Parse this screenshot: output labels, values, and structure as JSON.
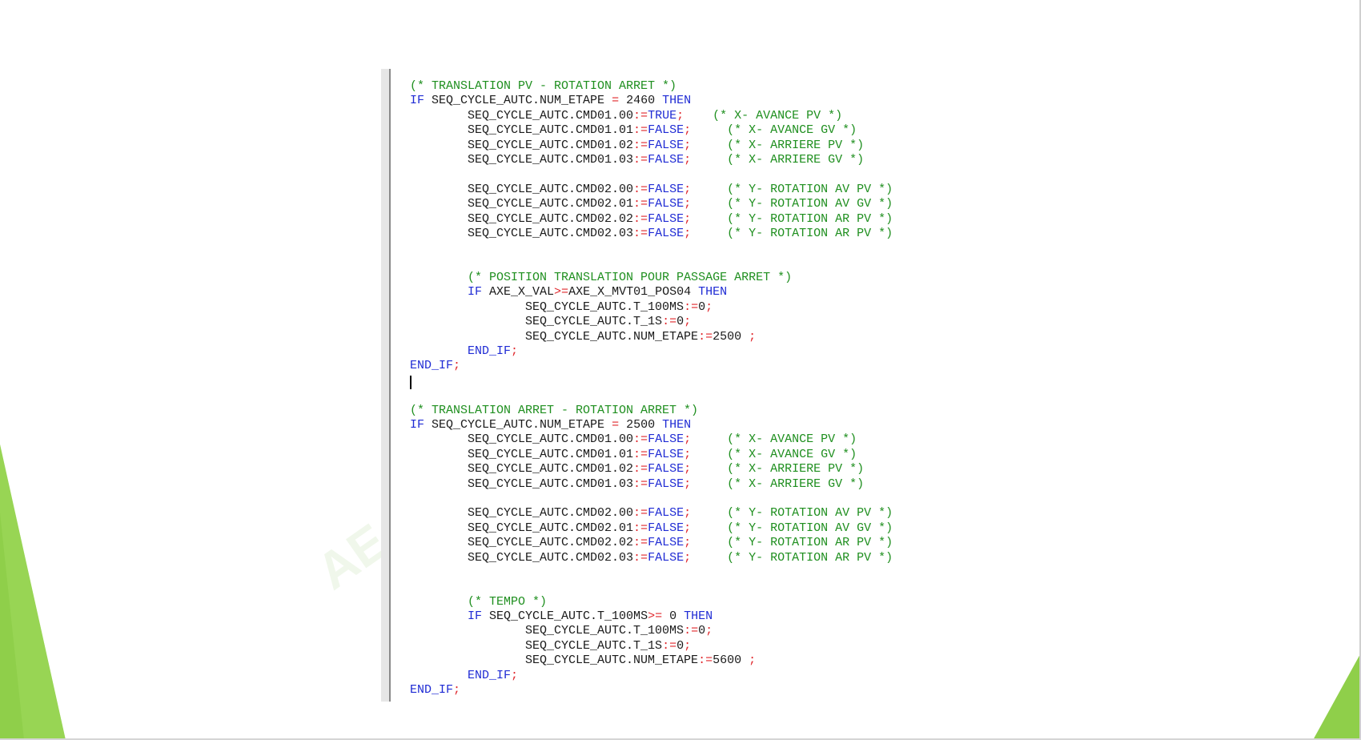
{
  "colors": {
    "comment": "#1f8f1f",
    "keyword": "#1f2bd4",
    "operator": "#e0282d",
    "text": "#1a1a1a",
    "accent_green": "#8fcf4a"
  },
  "watermark": "AE",
  "code_lines": [
    [
      {
        "t": "(* TRANSLATION PV - ROTATION ARRET *)",
        "c": "c"
      }
    ],
    [
      {
        "t": "IF",
        "c": "k"
      },
      {
        "t": " SEQ_CYCLE_AUTC.NUM_ETAPE "
      },
      {
        "t": "=",
        "c": "o"
      },
      {
        "t": " 2460 "
      },
      {
        "t": "THEN",
        "c": "k"
      }
    ],
    [
      {
        "t": "        SEQ_CYCLE_AUTC.CMD01.00"
      },
      {
        "t": ":=",
        "c": "o"
      },
      {
        "t": "TRUE",
        "c": "k"
      },
      {
        "t": ";",
        "c": "o"
      },
      {
        "t": "    "
      },
      {
        "t": "(* X- AVANCE PV *)",
        "c": "c"
      }
    ],
    [
      {
        "t": "        SEQ_CYCLE_AUTC.CMD01.01"
      },
      {
        "t": ":=",
        "c": "o"
      },
      {
        "t": "FALSE",
        "c": "k"
      },
      {
        "t": ";",
        "c": "o"
      },
      {
        "t": "     "
      },
      {
        "t": "(* X- AVANCE GV *)",
        "c": "c"
      }
    ],
    [
      {
        "t": "        SEQ_CYCLE_AUTC.CMD01.02"
      },
      {
        "t": ":=",
        "c": "o"
      },
      {
        "t": "FALSE",
        "c": "k"
      },
      {
        "t": ";",
        "c": "o"
      },
      {
        "t": "     "
      },
      {
        "t": "(* X- ARRIERE PV *)",
        "c": "c"
      }
    ],
    [
      {
        "t": "        SEQ_CYCLE_AUTC.CMD01.03"
      },
      {
        "t": ":=",
        "c": "o"
      },
      {
        "t": "FALSE",
        "c": "k"
      },
      {
        "t": ";",
        "c": "o"
      },
      {
        "t": "     "
      },
      {
        "t": "(* X- ARRIERE GV *)",
        "c": "c"
      }
    ],
    [],
    [
      {
        "t": "        SEQ_CYCLE_AUTC.CMD02.00"
      },
      {
        "t": ":=",
        "c": "o"
      },
      {
        "t": "FALSE",
        "c": "k"
      },
      {
        "t": ";",
        "c": "o"
      },
      {
        "t": "     "
      },
      {
        "t": "(* Y- ROTATION AV PV *)",
        "c": "c"
      }
    ],
    [
      {
        "t": "        SEQ_CYCLE_AUTC.CMD02.01"
      },
      {
        "t": ":=",
        "c": "o"
      },
      {
        "t": "FALSE",
        "c": "k"
      },
      {
        "t": ";",
        "c": "o"
      },
      {
        "t": "     "
      },
      {
        "t": "(* Y- ROTATION AV GV *)",
        "c": "c"
      }
    ],
    [
      {
        "t": "        SEQ_CYCLE_AUTC.CMD02.02"
      },
      {
        "t": ":=",
        "c": "o"
      },
      {
        "t": "FALSE",
        "c": "k"
      },
      {
        "t": ";",
        "c": "o"
      },
      {
        "t": "     "
      },
      {
        "t": "(* Y- ROTATION AR PV *)",
        "c": "c"
      }
    ],
    [
      {
        "t": "        SEQ_CYCLE_AUTC.CMD02.03"
      },
      {
        "t": ":=",
        "c": "o"
      },
      {
        "t": "FALSE",
        "c": "k"
      },
      {
        "t": ";",
        "c": "o"
      },
      {
        "t": "     "
      },
      {
        "t": "(* Y- ROTATION AR PV *)",
        "c": "c"
      }
    ],
    [],
    [],
    [
      {
        "t": "        "
      },
      {
        "t": "(* POSITION TRANSLATION POUR PASSAGE ARRET *)",
        "c": "c"
      }
    ],
    [
      {
        "t": "        "
      },
      {
        "t": "IF",
        "c": "k"
      },
      {
        "t": " AXE_X_VAL"
      },
      {
        "t": ">=",
        "c": "o"
      },
      {
        "t": "AXE_X_MVT01_POS04 "
      },
      {
        "t": "THEN",
        "c": "k"
      }
    ],
    [
      {
        "t": "                SEQ_CYCLE_AUTC.T_100MS"
      },
      {
        "t": ":=",
        "c": "o"
      },
      {
        "t": "0"
      },
      {
        "t": ";",
        "c": "o"
      }
    ],
    [
      {
        "t": "                SEQ_CYCLE_AUTC.T_1S"
      },
      {
        "t": ":=",
        "c": "o"
      },
      {
        "t": "0"
      },
      {
        "t": ";",
        "c": "o"
      }
    ],
    [
      {
        "t": "                SEQ_CYCLE_AUTC.NUM_ETAPE"
      },
      {
        "t": ":=",
        "c": "o"
      },
      {
        "t": "2500 "
      },
      {
        "t": ";",
        "c": "o"
      }
    ],
    [
      {
        "t": "        "
      },
      {
        "t": "END_IF",
        "c": "k"
      },
      {
        "t": ";",
        "c": "o"
      }
    ],
    [
      {
        "t": "END_IF",
        "c": "k"
      },
      {
        "t": ";",
        "c": "o"
      }
    ],
    [],
    [],
    [
      {
        "t": "(* TRANSLATION ARRET - ROTATION ARRET *)",
        "c": "c"
      }
    ],
    [
      {
        "t": "IF",
        "c": "k"
      },
      {
        "t": " SEQ_CYCLE_AUTC.NUM_ETAPE "
      },
      {
        "t": "=",
        "c": "o"
      },
      {
        "t": " 2500 "
      },
      {
        "t": "THEN",
        "c": "k"
      }
    ],
    [
      {
        "t": "        SEQ_CYCLE_AUTC.CMD01.00"
      },
      {
        "t": ":=",
        "c": "o"
      },
      {
        "t": "FALSE",
        "c": "k"
      },
      {
        "t": ";",
        "c": "o"
      },
      {
        "t": "     "
      },
      {
        "t": "(* X- AVANCE PV *)",
        "c": "c"
      }
    ],
    [
      {
        "t": "        SEQ_CYCLE_AUTC.CMD01.01"
      },
      {
        "t": ":=",
        "c": "o"
      },
      {
        "t": "FALSE",
        "c": "k"
      },
      {
        "t": ";",
        "c": "o"
      },
      {
        "t": "     "
      },
      {
        "t": "(* X- AVANCE GV *)",
        "c": "c"
      }
    ],
    [
      {
        "t": "        SEQ_CYCLE_AUTC.CMD01.02"
      },
      {
        "t": ":=",
        "c": "o"
      },
      {
        "t": "FALSE",
        "c": "k"
      },
      {
        "t": ";",
        "c": "o"
      },
      {
        "t": "     "
      },
      {
        "t": "(* X- ARRIERE PV *)",
        "c": "c"
      }
    ],
    [
      {
        "t": "        SEQ_CYCLE_AUTC.CMD01.03"
      },
      {
        "t": ":=",
        "c": "o"
      },
      {
        "t": "FALSE",
        "c": "k"
      },
      {
        "t": ";",
        "c": "o"
      },
      {
        "t": "     "
      },
      {
        "t": "(* X- ARRIERE GV *)",
        "c": "c"
      }
    ],
    [],
    [
      {
        "t": "        SEQ_CYCLE_AUTC.CMD02.00"
      },
      {
        "t": ":=",
        "c": "o"
      },
      {
        "t": "FALSE",
        "c": "k"
      },
      {
        "t": ";",
        "c": "o"
      },
      {
        "t": "     "
      },
      {
        "t": "(* Y- ROTATION AV PV *)",
        "c": "c"
      }
    ],
    [
      {
        "t": "        SEQ_CYCLE_AUTC.CMD02.01"
      },
      {
        "t": ":=",
        "c": "o"
      },
      {
        "t": "FALSE",
        "c": "k"
      },
      {
        "t": ";",
        "c": "o"
      },
      {
        "t": "     "
      },
      {
        "t": "(* Y- ROTATION AV GV *)",
        "c": "c"
      }
    ],
    [
      {
        "t": "        SEQ_CYCLE_AUTC.CMD02.02"
      },
      {
        "t": ":=",
        "c": "o"
      },
      {
        "t": "FALSE",
        "c": "k"
      },
      {
        "t": ";",
        "c": "o"
      },
      {
        "t": "     "
      },
      {
        "t": "(* Y- ROTATION AR PV *)",
        "c": "c"
      }
    ],
    [
      {
        "t": "        SEQ_CYCLE_AUTC.CMD02.03"
      },
      {
        "t": ":=",
        "c": "o"
      },
      {
        "t": "FALSE",
        "c": "k"
      },
      {
        "t": ";",
        "c": "o"
      },
      {
        "t": "     "
      },
      {
        "t": "(* Y- ROTATION AR PV *)",
        "c": "c"
      }
    ],
    [],
    [],
    [
      {
        "t": "        "
      },
      {
        "t": "(* TEMPO *)",
        "c": "c"
      }
    ],
    [
      {
        "t": "        "
      },
      {
        "t": "IF",
        "c": "k"
      },
      {
        "t": " SEQ_CYCLE_AUTC.T_100MS"
      },
      {
        "t": ">=",
        "c": "o"
      },
      {
        "t": " 0 "
      },
      {
        "t": "THEN",
        "c": "k"
      }
    ],
    [
      {
        "t": "                SEQ_CYCLE_AUTC.T_100MS"
      },
      {
        "t": ":=",
        "c": "o"
      },
      {
        "t": "0"
      },
      {
        "t": ";",
        "c": "o"
      }
    ],
    [
      {
        "t": "                SEQ_CYCLE_AUTC.T_1S"
      },
      {
        "t": ":=",
        "c": "o"
      },
      {
        "t": "0"
      },
      {
        "t": ";",
        "c": "o"
      }
    ],
    [
      {
        "t": "                SEQ_CYCLE_AUTC.NUM_ETAPE"
      },
      {
        "t": ":=",
        "c": "o"
      },
      {
        "t": "5600 "
      },
      {
        "t": ";",
        "c": "o"
      }
    ],
    [
      {
        "t": "        "
      },
      {
        "t": "END_IF",
        "c": "k"
      },
      {
        "t": ";",
        "c": "o"
      }
    ],
    [
      {
        "t": "END_IF",
        "c": "k"
      },
      {
        "t": ";",
        "c": "o"
      }
    ]
  ],
  "caret_line": 20
}
